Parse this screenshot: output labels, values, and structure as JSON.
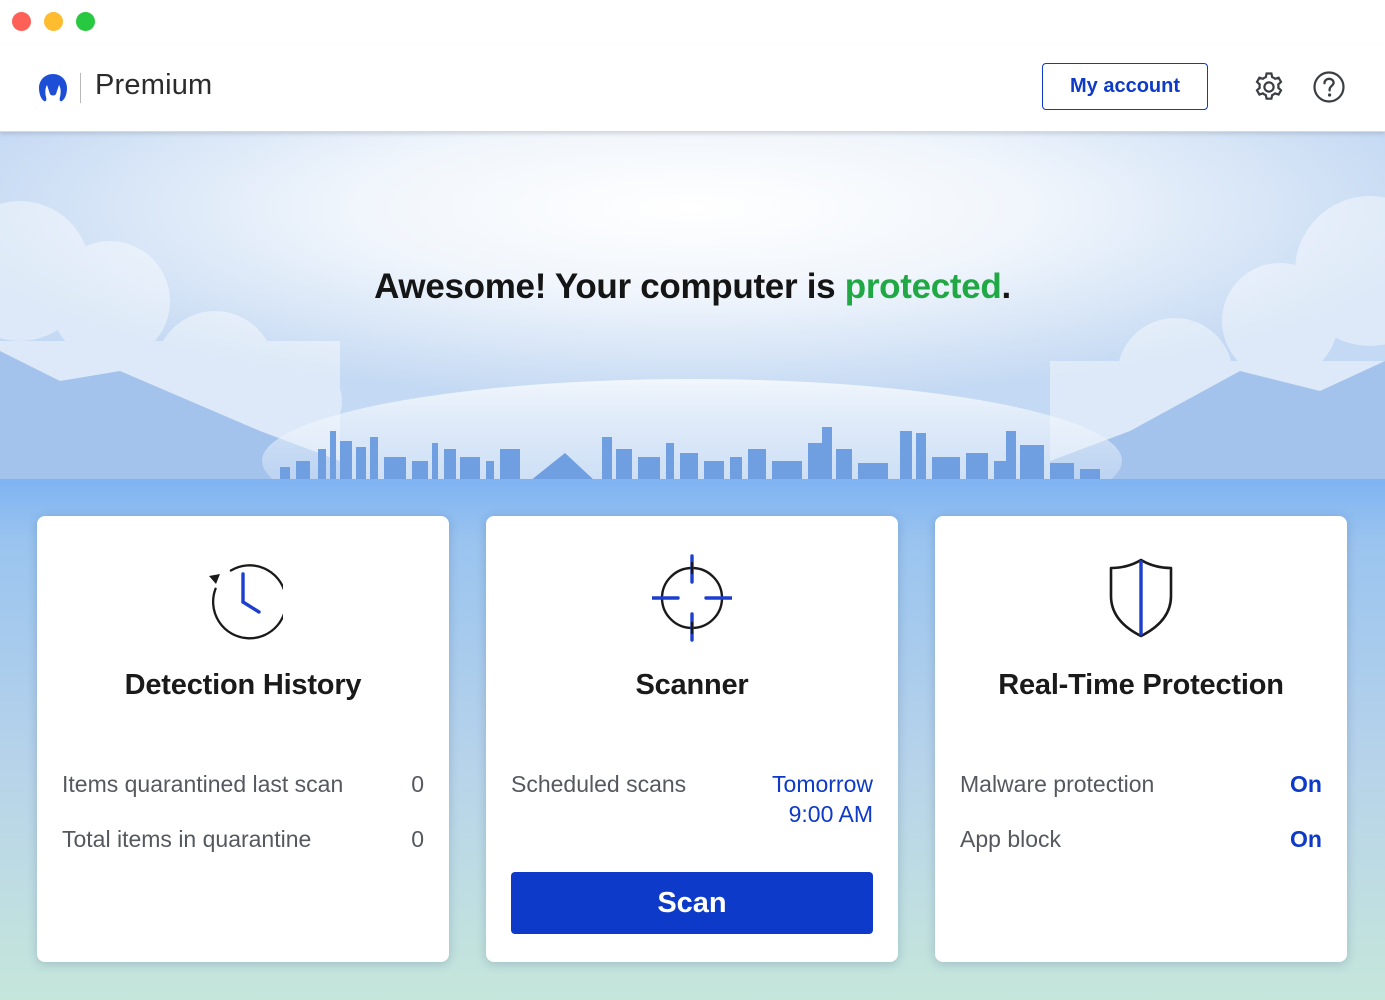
{
  "window": {
    "title_buttons": [
      "close",
      "minimize",
      "maximize"
    ]
  },
  "header": {
    "logo_icon": "malwarebytes-logo-icon",
    "product_name": "Premium",
    "account_label": "My account",
    "settings_icon": "gear-icon",
    "help_icon": "question-circle-icon"
  },
  "hero": {
    "message_prefix": "Awesome! Your computer is ",
    "status_word": "protected",
    "message_suffix": ".",
    "status_color": "#1fa844"
  },
  "cards": [
    {
      "icon": "clock-history-icon",
      "title": "Detection History",
      "rows": [
        {
          "label": "Items quarantined last scan",
          "value": "0"
        },
        {
          "label": "Total items in quarantine",
          "value": "0"
        }
      ]
    },
    {
      "icon": "crosshair-icon",
      "title": "Scanner",
      "rows": [
        {
          "label": "Scheduled scans",
          "value_line1": "Tomorrow",
          "value_line2": "9:00 AM"
        }
      ],
      "button_label": "Scan"
    },
    {
      "icon": "shield-icon",
      "title": "Real-Time Protection",
      "rows": [
        {
          "label": "Malware protection",
          "value": "On"
        },
        {
          "label": "App block",
          "value": "On"
        }
      ]
    }
  ],
  "colors": {
    "accent": "#0d3ac8",
    "protected_green": "#1fa844",
    "text_dark": "#1a1a1a",
    "text_muted": "#55595f"
  }
}
